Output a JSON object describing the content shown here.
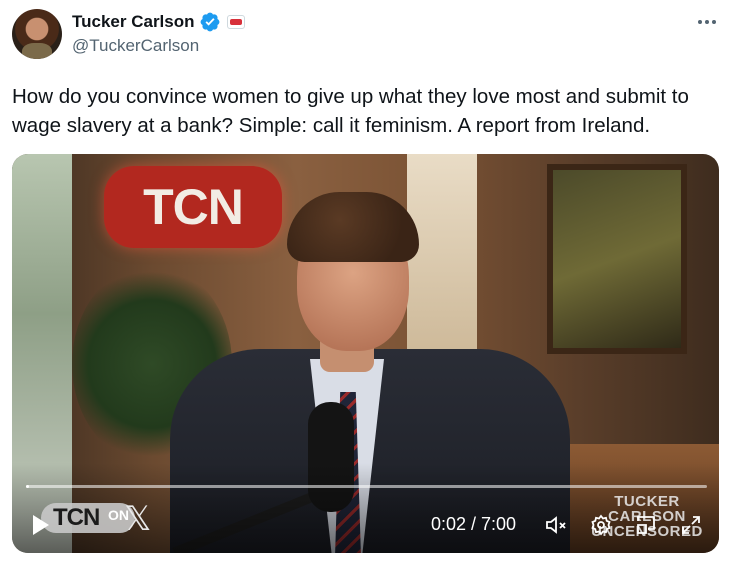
{
  "author": {
    "display_name": "Tucker Carlson",
    "handle": "@TuckerCarlson",
    "verified_icon": "verified-badge-icon",
    "affiliate_badge": "TCN"
  },
  "tweet": {
    "text": "How do you convince women to give up what they love most and submit to wage slavery at a bank? Simple: call it feminism. A report from Ireland."
  },
  "video": {
    "sign_text": "TCN",
    "logo_text": "TCN",
    "logo_on": "ON",
    "logo_x": "𝕏",
    "watermark_line1": "TUCKER",
    "watermark_line2": "CARLSON",
    "watermark_line3": "UNCENSORED",
    "current_time": "0:02",
    "total_time": "7:00",
    "time_display": "0:02 / 7:00",
    "progress_fraction": 0.005,
    "icons": [
      "play-icon",
      "mute-icon",
      "settings-icon",
      "minimize-icon",
      "fullscreen-icon"
    ]
  },
  "colors": {
    "verified_blue": "#1d9bf0",
    "text_primary": "#0f1419",
    "text_secondary": "#536471",
    "tcn_red": "#b2281f"
  }
}
